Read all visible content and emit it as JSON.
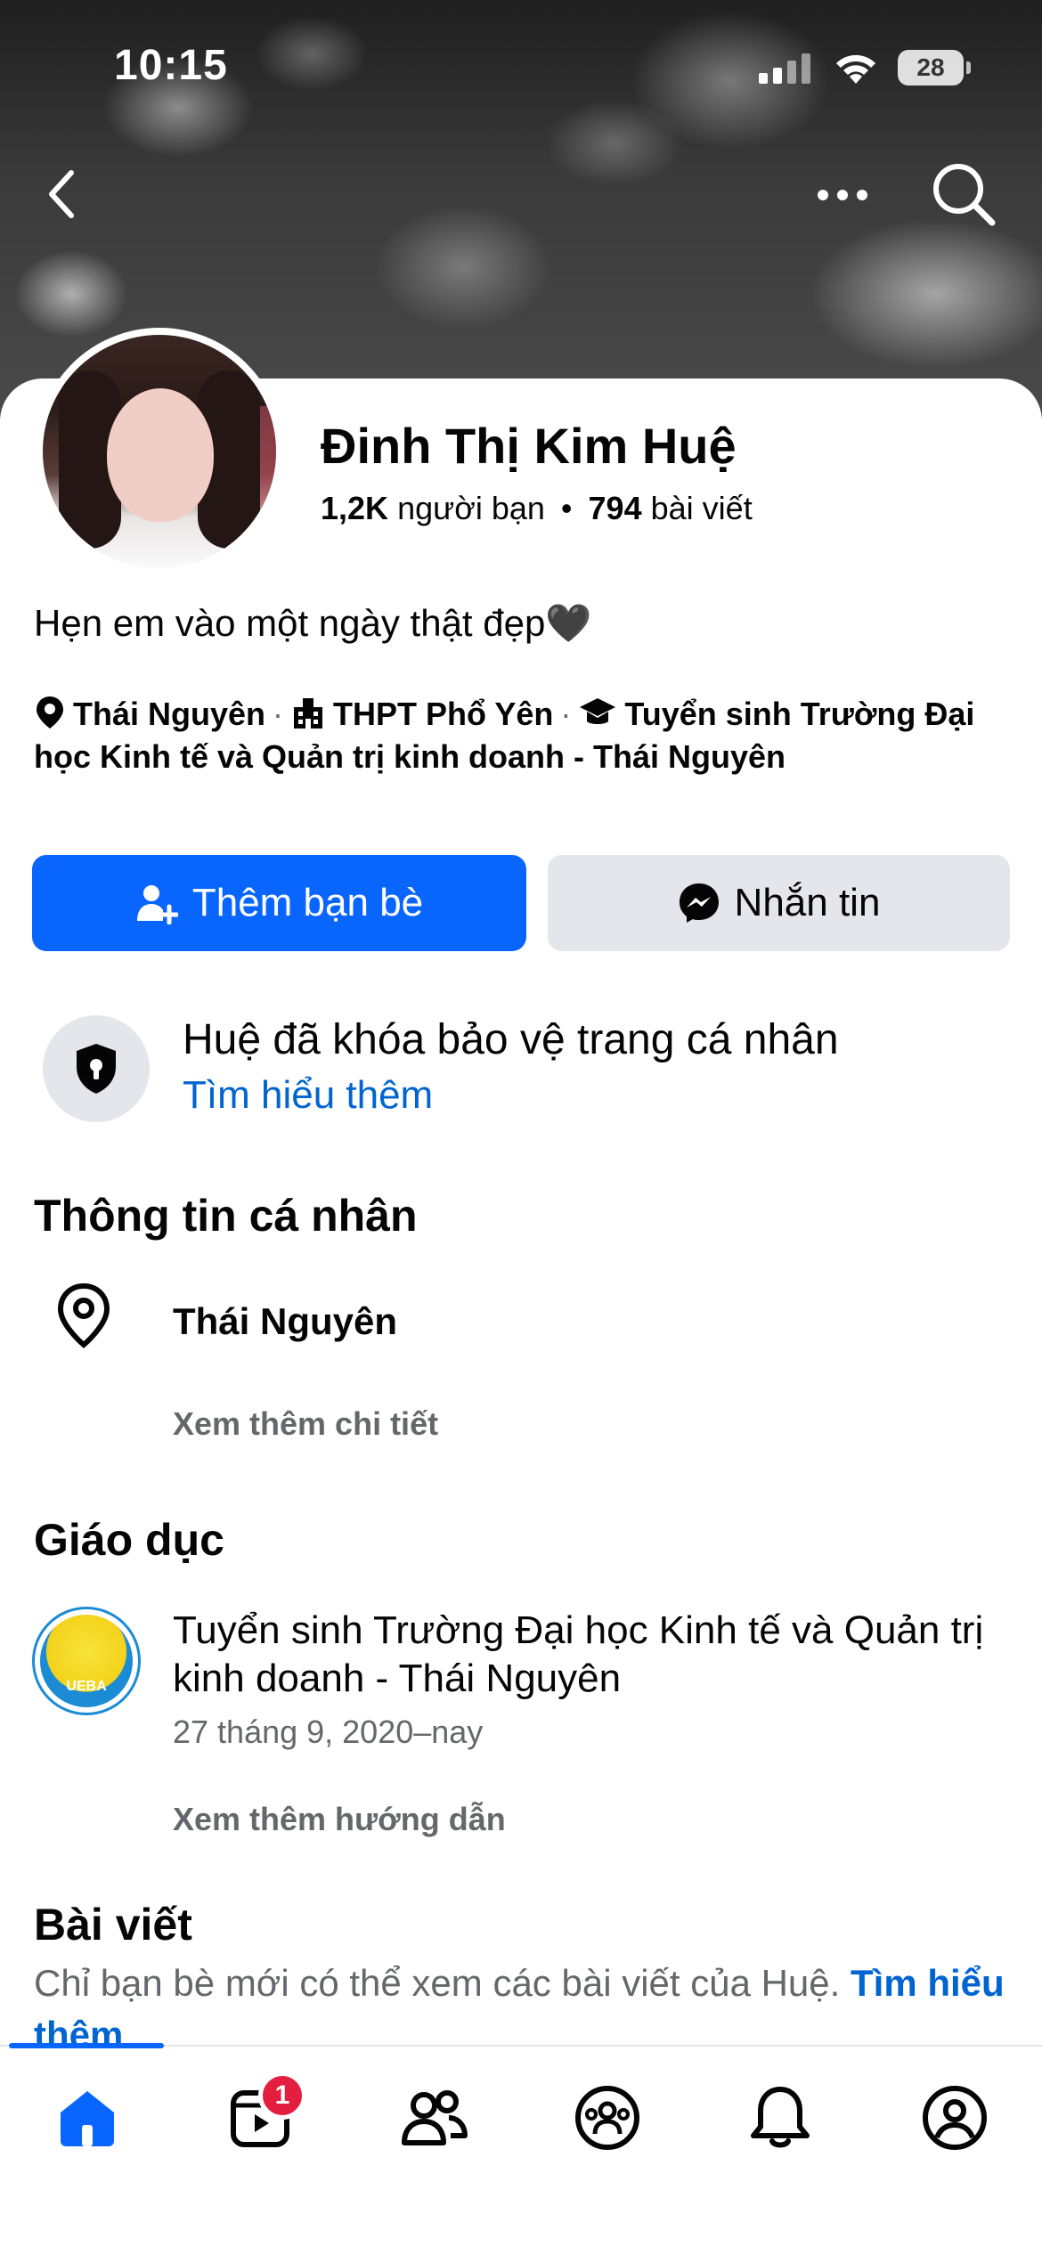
{
  "status_bar": {
    "time": "10:15",
    "battery": "28"
  },
  "profile": {
    "name": "Đinh Thị Kim Huệ",
    "friends_count": "1,2K",
    "friends_label": "người bạn",
    "separator": "•",
    "posts_count": "794",
    "posts_label": "bài viết",
    "bio": "Hẹn em vào một ngày thật đẹp🖤",
    "details": {
      "location": "Thái Nguyên",
      "school": "THPT Phổ Yên",
      "university": "Tuyển sinh Trường Đại học Kinh tế và Quản trị kinh doanh - Thái Nguyên",
      "dot": "·"
    }
  },
  "actions": {
    "add_friend": "Thêm bạn bè",
    "message": "Nhắn tin"
  },
  "lock_notice": {
    "title": "Huệ đã khóa bảo vệ trang cá nhân",
    "link": "Tìm hiểu thêm"
  },
  "personal_info": {
    "heading": "Thông tin cá nhân",
    "location": "Thái Nguyên",
    "more": "Xem thêm chi tiết"
  },
  "education": {
    "heading": "Giáo dục",
    "logo_text": "UEBA",
    "school": "Tuyển sinh Trường Đại học Kinh tế và Quản trị kinh doanh - Thái Nguyên",
    "date": "27 tháng 9, 2020–nay",
    "more": "Xem thêm hướng dẫn"
  },
  "posts": {
    "heading": "Bài viết",
    "note": "Chỉ bạn bè mới có thể xem các bài viết của Huệ. ",
    "link": "Tìm hiểu thêm"
  },
  "tabbar": {
    "items": [
      "home-icon",
      "video-icon",
      "friends-icon",
      "groups-icon",
      "notifications-icon",
      "profile-icon"
    ],
    "video_badge": "1",
    "active_color": "#0866ff"
  },
  "colors": {
    "brand": "#0866ff",
    "link": "#0064d1",
    "secondary_text": "#65676b",
    "button_gray": "#e4e6eb"
  }
}
